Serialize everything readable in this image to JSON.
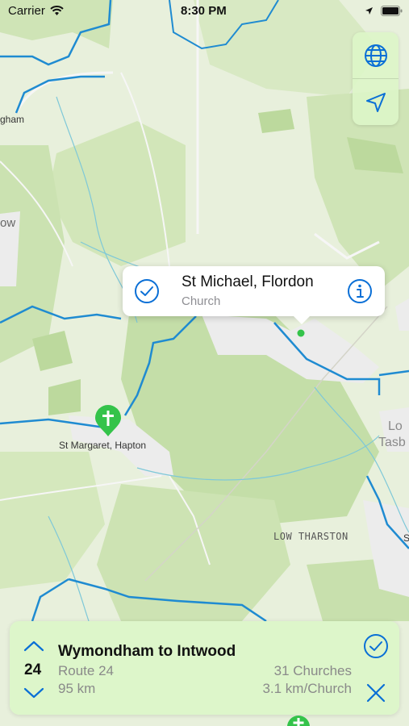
{
  "status_bar": {
    "carrier": "Carrier",
    "time": "8:30 PM"
  },
  "map_controls": {
    "globe_icon": "globe-icon",
    "location_icon": "location-arrow-icon"
  },
  "callout": {
    "title": "St Michael, Flordon",
    "subtitle": "Church",
    "check_icon": "checkmark-circle-icon",
    "info_icon": "info-circle-icon"
  },
  "map_labels": {
    "hapton": "St Margaret, Hapton",
    "low_tharston": "LOW THARSTON",
    "edge_gham": "gham",
    "edge_ow": "ow",
    "edge_lo": "Lo",
    "edge_tasb": "Tasb",
    "edge_s": "S"
  },
  "route_panel": {
    "title": "Wymondham to Intwood",
    "route_number": "24",
    "route_label": "Route 24",
    "distance": "95 km",
    "churches": "31 Churches",
    "per_church": "3.1 km/Church"
  },
  "colors": {
    "accent": "#0a6fd6",
    "pin": "#34c34a",
    "road": "#1f8bd1",
    "map_bg": "#e6efd9"
  }
}
